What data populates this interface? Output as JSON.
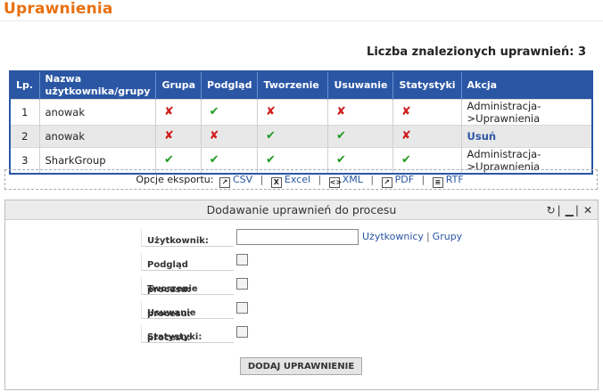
{
  "page": {
    "title": "Uprawnienia"
  },
  "summary": {
    "count_label": "Liczba znalezionych uprawnień: 3"
  },
  "table": {
    "headers": {
      "lp": "Lp.",
      "name": "Nazwa użytkownika/grupy",
      "group": "Grupa",
      "view": "Podgląd",
      "create": "Tworzenie",
      "delete": "Usuwanie",
      "stats": "Statystyki",
      "action": "Akcja"
    },
    "rows": [
      {
        "lp": "1",
        "name": "anowak",
        "group": "✘",
        "view": "✔",
        "create": "✘",
        "delete": "✘",
        "stats": "✘",
        "action": "Administracja->Uprawnienia"
      },
      {
        "lp": "2",
        "name": "anowak",
        "group": "✘",
        "view": "✘",
        "create": "✔",
        "delete": "✔",
        "stats": "✘",
        "action": "Usuń"
      },
      {
        "lp": "3",
        "name": "SharkGroup",
        "group": "✔",
        "view": "✔",
        "create": "✔",
        "delete": "✔",
        "stats": "✔",
        "action": "Administracja->Uprawnienia"
      }
    ]
  },
  "export": {
    "label": "Opcje eksportu:",
    "csv": "CSV",
    "excel": "Excel",
    "xml": "XML",
    "pdf": "PDF",
    "rtf": "RTF",
    "separator": "|"
  },
  "panel": {
    "title": "Dodawanie uprawnień do procesu",
    "refresh_icon": "↻",
    "minimize_icon": "▁",
    "close_icon": "✕",
    "tools_separator": "|"
  },
  "form": {
    "user_label": "Użytkownik:",
    "user_value": "",
    "users_link": "Użytkownicy",
    "groups_link": "Grupy",
    "link_separator": "|",
    "view_label": "Podgląd procesu:",
    "create_label": "Tworzenie procesu:",
    "delete_label": "Usuwanie procesu:",
    "stats_label": "Statystyki:",
    "submit_label": "DODAJ UPRAWNIENIE"
  },
  "colors": {
    "accent": "#e8700f",
    "header_blue": "#2a56a4",
    "yes": "#1f9a1f",
    "no": "#d01a1a"
  }
}
